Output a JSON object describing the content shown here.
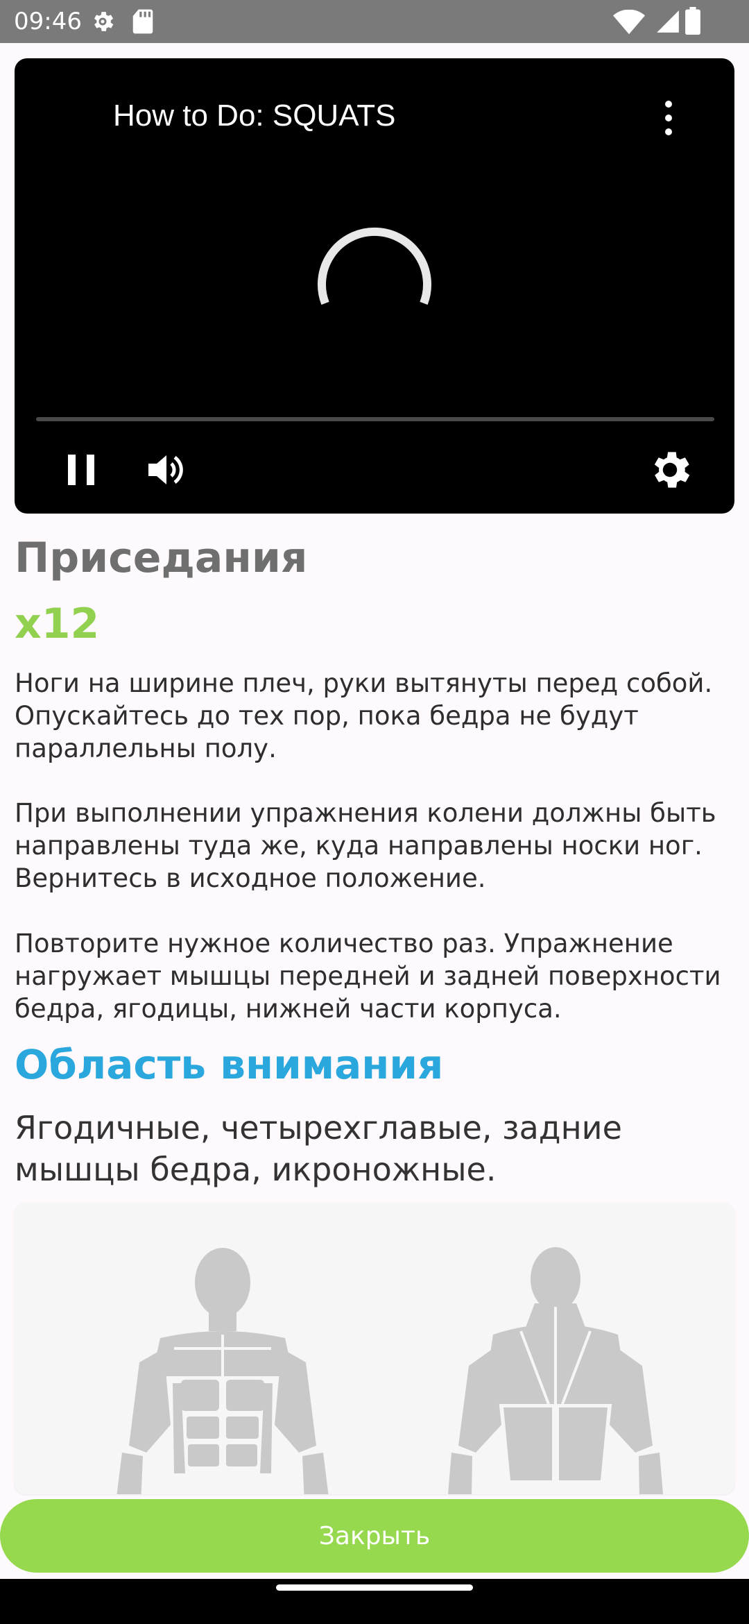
{
  "status_bar": {
    "time": "09:46",
    "icons": [
      "settings-icon",
      "sd-card-icon",
      "wifi-icon",
      "signal-icon",
      "battery-icon"
    ]
  },
  "video": {
    "title": "How to Do: SQUATS",
    "progress": 0,
    "icons": [
      "more-vertical-icon",
      "loading-spinner-icon",
      "pause-icon",
      "volume-icon",
      "settings-icon"
    ]
  },
  "exercise": {
    "title": "Приседания",
    "reps": "x12",
    "description": [
      "Ноги на ширине плеч, руки вытянуты перед собой. Опускайтесь до тех пор, пока бедра не будут параллельны полу.",
      "При выполнении упражнения колени должны быть направлены туда же, куда направлены носки ног. Вернитесь в исходное положение.",
      "Повторите нужное количество раз. Упражнение нагружает мышцы передней и задней поверхности бедра, ягодицы, нижней части корпуса."
    ]
  },
  "focus": {
    "title": "Область внимания",
    "muscles": "Ягодичные, четырехглавые, задние мышцы бедра, икроножные."
  },
  "close_button": {
    "label": "Закрыть"
  },
  "colors": {
    "title_gray": "#6f6f6f",
    "reps_green": "#92d050",
    "focus_blue": "#2aa7dc",
    "button_green": "#96d84e",
    "muscle_highlight": "#1565e0"
  }
}
